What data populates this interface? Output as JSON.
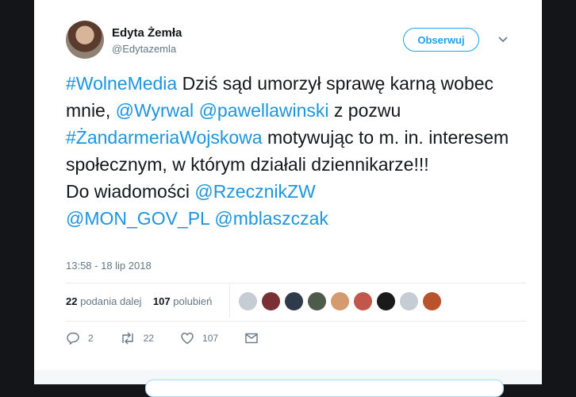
{
  "author": {
    "display_name": "Edyta Żemła",
    "handle": "@Edytazemla"
  },
  "follow_label": "Obserwuj",
  "tweet": {
    "segments": [
      {
        "text": "#WolneMedia",
        "link": true
      },
      {
        "text": " Dziś sąd umorzył sprawę karną wobec mnie, ",
        "link": false
      },
      {
        "text": "@Wyrwal",
        "link": true
      },
      {
        "text": " ",
        "link": false
      },
      {
        "text": "@pawellawinski",
        "link": true
      },
      {
        "text": " z pozwu ",
        "link": false
      },
      {
        "text": "#ŻandarmeriaWojskowa",
        "link": true
      },
      {
        "text": " motywując to m. in. interesem społecznym, w którym działali dziennikarze!!!",
        "link": false
      },
      {
        "text": "\nDo wiadomości ",
        "link": false
      },
      {
        "text": "@RzecznikZW",
        "link": true
      },
      {
        "text": "\n",
        "link": false
      },
      {
        "text": "@MON_GOV_PL",
        "link": true
      },
      {
        "text": " ",
        "link": false
      },
      {
        "text": "@mblaszczak",
        "link": true
      }
    ]
  },
  "timestamp": "13:58 - 18 lip 2018",
  "stats": {
    "retweets_count": "22",
    "retweets_label": "podania dalej",
    "likes_count": "107",
    "likes_label": "polubień"
  },
  "liker_avatars": [
    {
      "color": "#c5ccd3"
    },
    {
      "color": "#7a2f34"
    },
    {
      "color": "#2d3b4a"
    },
    {
      "color": "#4e5b4b"
    },
    {
      "color": "#d59a6e"
    },
    {
      "color": "#c0574a"
    },
    {
      "color": "#1a1a1a"
    },
    {
      "color": "#c5ccd3"
    },
    {
      "color": "#b8532e"
    }
  ],
  "actions": {
    "reply_count": "2",
    "retweet_count": "22",
    "like_count": "107"
  },
  "colors": {
    "accent": "#1da1f2",
    "link": "#1b95e0"
  },
  "icons": [
    "caret-down-icon",
    "reply-icon",
    "retweet-icon",
    "like-icon",
    "message-icon"
  ]
}
